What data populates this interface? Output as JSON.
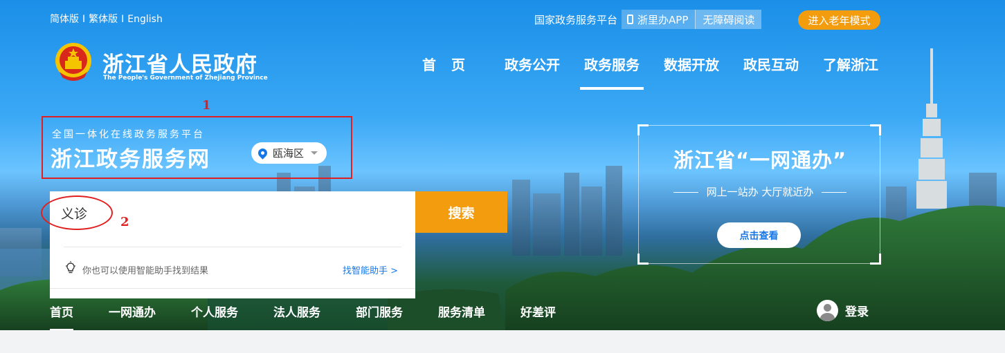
{
  "topbar": {
    "languages": [
      "简体版",
      "繁体版",
      "English"
    ],
    "separator": "I",
    "national_platform": "国家政务服务平台",
    "app_button": "浙里办APP",
    "accessibility_button": "无障碍阅读",
    "elder_mode_button": "进入老年模式"
  },
  "logo": {
    "name": "浙江省人民政府",
    "name_en": "The People's Government of Zhejiang Province"
  },
  "main_nav": {
    "items": [
      "首页",
      "政务公开",
      "政务服务",
      "数据开放",
      "政民互动",
      "了解浙江"
    ],
    "active": "政务服务"
  },
  "platform": {
    "subtitle": "全国一体化在线政务服务平台",
    "title": "浙江政务服务网",
    "region": "瓯海区"
  },
  "annotations": {
    "label_1": "1",
    "label_2": "2"
  },
  "search": {
    "value": "义诊",
    "button": "搜索",
    "hint": "你也可以使用智能助手找到结果",
    "assistant_link": "找智能助手 >"
  },
  "card": {
    "title": "浙江省“一网通办”",
    "subtitle": "网上一站办 大厅就近办",
    "button": "点击查看"
  },
  "sub_nav": {
    "items": [
      "首页",
      "一网通办",
      "个人服务",
      "法人服务",
      "部门服务",
      "服务清单",
      "好差评"
    ],
    "active": "首页",
    "login": "登录"
  },
  "colors": {
    "accent_orange": "#f29c0e",
    "link_blue": "#1678e8",
    "annotation_red": "#e02020"
  }
}
